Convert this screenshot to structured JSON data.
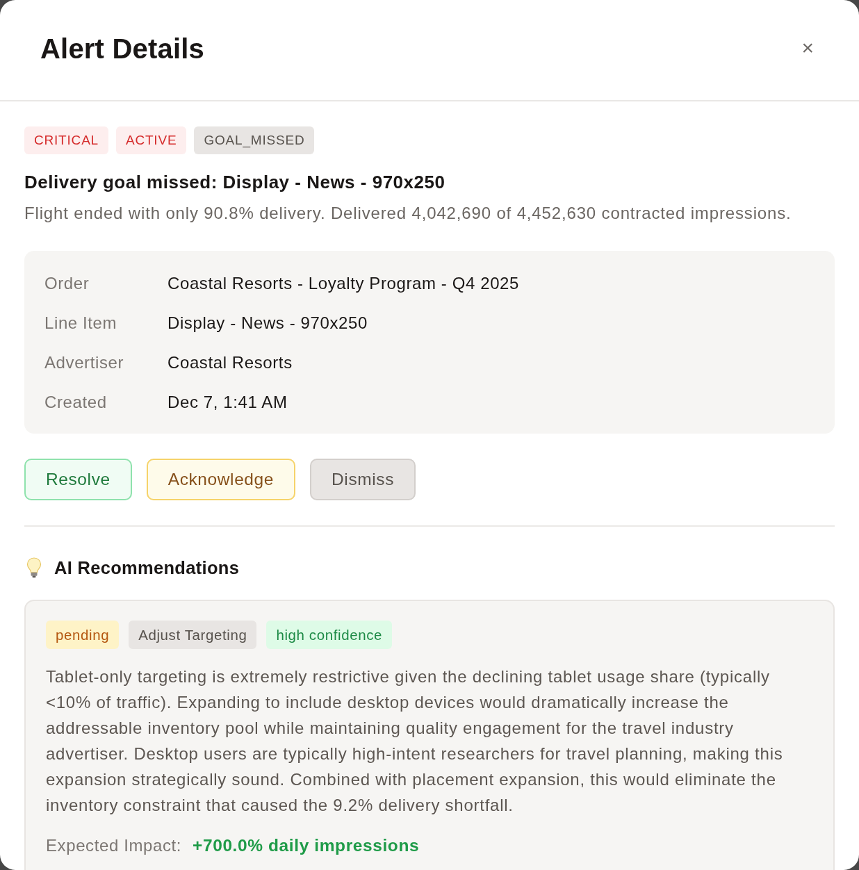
{
  "dialog": {
    "title": "Alert Details",
    "close": "×"
  },
  "alert": {
    "badges": [
      {
        "label": "CRITICAL",
        "kind": "danger"
      },
      {
        "label": "ACTIVE",
        "kind": "danger"
      },
      {
        "label": "GOAL_MISSED",
        "kind": "neutral"
      }
    ],
    "title": "Delivery goal missed: Display - News - 970x250",
    "description": "Flight ended with only 90.8% delivery. Delivered 4,042,690 of 4,452,630 contracted impressions."
  },
  "details": [
    {
      "label": "Order",
      "value": "Coastal Resorts - Loyalty Program - Q4 2025"
    },
    {
      "label": "Line Item",
      "value": "Display - News - 970x250"
    },
    {
      "label": "Advertiser",
      "value": "Coastal Resorts"
    },
    {
      "label": "Created",
      "value": "Dec 7, 1:41 AM"
    }
  ],
  "actions": [
    {
      "label": "Resolve",
      "kind": "success"
    },
    {
      "label": "Acknowledge",
      "kind": "warning"
    },
    {
      "label": "Dismiss",
      "kind": "neutral"
    }
  ],
  "recommendations": {
    "heading": "AI Recommendations",
    "items": [
      {
        "tags": [
          {
            "label": "pending",
            "kind": "warning"
          },
          {
            "label": "Adjust Targeting",
            "kind": "neutral"
          },
          {
            "label": "high confidence",
            "kind": "success"
          }
        ],
        "text": "Tablet-only targeting is extremely restrictive given the declining tablet usage share (typically <10% of traffic). Expanding to include desktop devices would dramatically increase the addressable inventory pool while maintaining quality engagement for the travel industry advertiser. Desktop users are typically high-intent researchers for travel planning, making this expansion strategically sound. Combined with placement expansion, this would eliminate the inventory constraint that caused the 9.2% delivery shortfall.",
        "impact_label": "Expected Impact:",
        "impact_value": "+700.0% daily impressions"
      }
    ]
  }
}
